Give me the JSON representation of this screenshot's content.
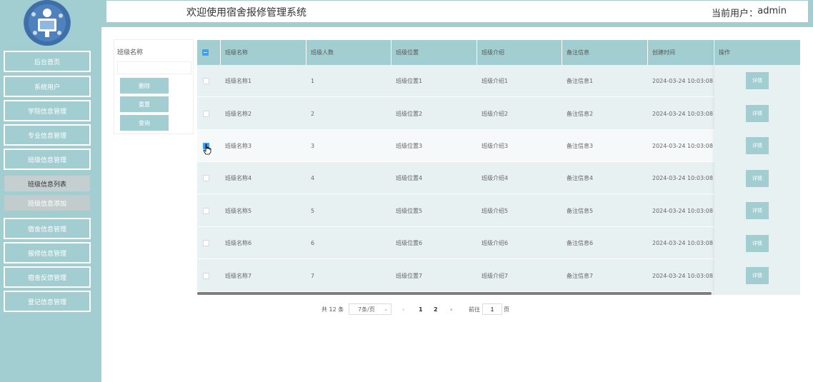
{
  "header": {
    "site_title": "欢迎使用宿舍报修管理系统",
    "user_label": "当前用户：",
    "user_name": "admin"
  },
  "sidebar": {
    "items": [
      {
        "label": "后台首页"
      },
      {
        "label": "系统用户"
      },
      {
        "label": "学院信息管理"
      },
      {
        "label": "专业信息管理"
      },
      {
        "label": "班级信息管理"
      },
      {
        "label": "宿舍信息管理"
      },
      {
        "label": "报修信息管理"
      },
      {
        "label": "宿舍反馈管理"
      },
      {
        "label": "登记信息管理"
      }
    ],
    "sub_items": [
      {
        "label": "班级信息列表"
      },
      {
        "label": "班级信息添加"
      }
    ]
  },
  "search": {
    "field_label": "班级名称",
    "field_value": "",
    "delete_label": "删除",
    "reset_label": "重置",
    "query_label": "查询"
  },
  "table": {
    "columns": [
      "班级名称",
      "班级人数",
      "班级位置",
      "班级介绍",
      "备注信息",
      "创建时间",
      "操作"
    ],
    "rows": [
      {
        "name": "班级名称1",
        "count": "1",
        "location": "班级位置1",
        "intro": "班级介绍1",
        "remark": "备注信息1",
        "created": "2024-03-24 10:03:08",
        "action": "详情",
        "checked": false
      },
      {
        "name": "班级名称2",
        "count": "2",
        "location": "班级位置2",
        "intro": "班级介绍2",
        "remark": "备注信息2",
        "created": "2024-03-24 10:03:08",
        "action": "详情",
        "checked": false
      },
      {
        "name": "班级名称3",
        "count": "3",
        "location": "班级位置3",
        "intro": "班级介绍3",
        "remark": "备注信息3",
        "created": "2024-03-24 10:03:08",
        "action": "详情",
        "checked": true
      },
      {
        "name": "班级名称4",
        "count": "4",
        "location": "班级位置4",
        "intro": "班级介绍4",
        "remark": "备注信息4",
        "created": "2024-03-24 10:03:08",
        "action": "详情",
        "checked": false
      },
      {
        "name": "班级名称5",
        "count": "5",
        "location": "班级位置5",
        "intro": "班级介绍5",
        "remark": "备注信息5",
        "created": "2024-03-24 10:03:08",
        "action": "详情",
        "checked": false
      },
      {
        "name": "班级名称6",
        "count": "6",
        "location": "班级位置6",
        "intro": "班级介绍6",
        "remark": "备注信息6",
        "created": "2024-03-24 10:03:08",
        "action": "详情",
        "checked": false
      },
      {
        "name": "班级名称7",
        "count": "7",
        "location": "班级位置7",
        "intro": "班级介绍7",
        "remark": "备注信息7",
        "created": "2024-03-24 10:03:08",
        "action": "详情",
        "checked": false
      }
    ]
  },
  "pagination": {
    "total_text": "共 12 条",
    "page_size": "7条/页",
    "prev": "‹",
    "page1": "1",
    "page2": "2",
    "next": "›",
    "goto_label": "前往",
    "goto_value": "1",
    "page_unit": "页"
  },
  "colors": {
    "sidebar_bg": "#a3ced1",
    "accent": "#a3ced1",
    "checkbox": "#409eff"
  }
}
